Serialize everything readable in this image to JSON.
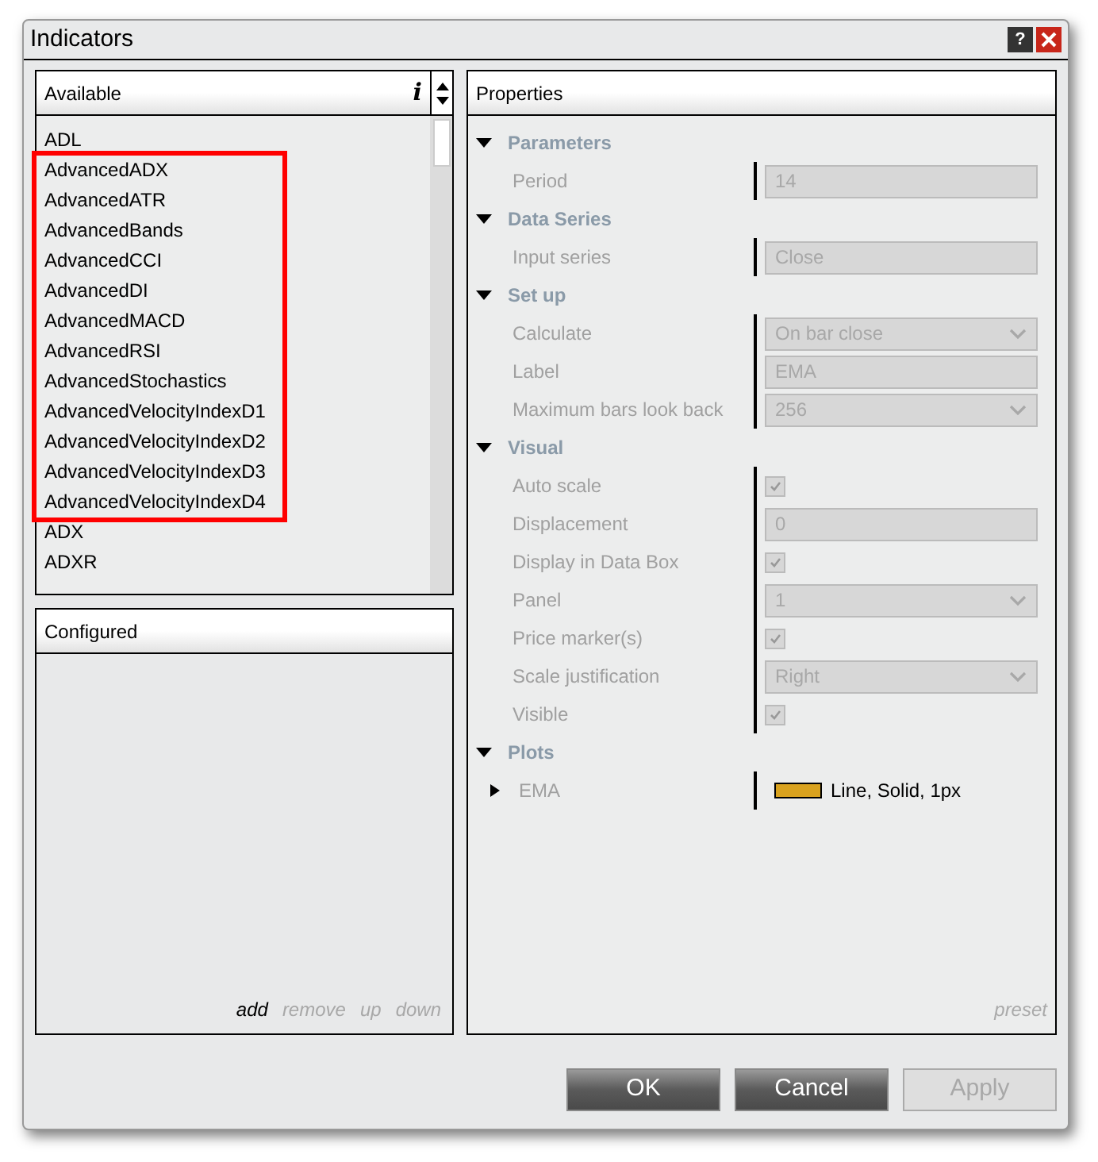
{
  "window": {
    "title": "Indicators",
    "help": "?"
  },
  "available": {
    "title": "Available",
    "info": "i",
    "items": [
      {
        "kind": "item",
        "label": "ADL"
      },
      {
        "kind": "highlight",
        "items": [
          {
            "label": "AdvancedADX"
          },
          {
            "label": "AdvancedATR"
          },
          {
            "label": "AdvancedBands"
          },
          {
            "label": "AdvancedCCI"
          },
          {
            "label": "AdvancedDI"
          },
          {
            "label": "AdvancedMACD"
          },
          {
            "label": "AdvancedRSI"
          },
          {
            "label": "AdvancedStochastics"
          },
          {
            "label": "AdvancedVelocityIndexD1"
          },
          {
            "label": "AdvancedVelocityIndexD2"
          },
          {
            "label": "AdvancedVelocityIndexD3"
          },
          {
            "label": "AdvancedVelocityIndexD4"
          }
        ]
      },
      {
        "kind": "item",
        "label": "ADX"
      },
      {
        "kind": "item",
        "label": "ADXR"
      }
    ]
  },
  "configured": {
    "title": "Configured",
    "actions": [
      {
        "label": "add",
        "disabled": false
      },
      {
        "label": "remove",
        "disabled": true
      },
      {
        "label": "up",
        "disabled": true
      },
      {
        "label": "down",
        "disabled": true
      }
    ]
  },
  "properties": {
    "title": "Properties",
    "footer": "preset",
    "categories": [
      {
        "name": "Parameters",
        "expanded": true,
        "rows": [
          {
            "kind": "text",
            "label": "Period",
            "value": "14"
          }
        ]
      },
      {
        "name": "Data Series",
        "expanded": true,
        "rows": [
          {
            "kind": "text",
            "label": "Input series",
            "value": "Close"
          }
        ]
      },
      {
        "name": "Set up",
        "expanded": true,
        "rows": [
          {
            "kind": "dropdown",
            "label": "Calculate",
            "value": "On bar close"
          },
          {
            "kind": "text",
            "label": "Label",
            "value": "EMA"
          },
          {
            "kind": "dropdown",
            "label": "Maximum bars look back",
            "value": "256"
          }
        ]
      },
      {
        "name": "Visual",
        "expanded": true,
        "rows": [
          {
            "kind": "checkbox",
            "label": "Auto scale",
            "checked": true
          },
          {
            "kind": "text",
            "label": "Displacement",
            "value": "0"
          },
          {
            "kind": "checkbox",
            "label": "Display in Data Box",
            "checked": true
          },
          {
            "kind": "dropdown",
            "label": "Panel",
            "value": "1"
          },
          {
            "kind": "checkbox",
            "label": "Price marker(s)",
            "checked": true
          },
          {
            "kind": "dropdown",
            "label": "Scale justification",
            "value": "Right"
          },
          {
            "kind": "checkbox",
            "label": "Visible",
            "checked": true
          }
        ]
      },
      {
        "name": "Plots",
        "expanded": true,
        "rows": [
          {
            "kind": "plot",
            "label": "EMA",
            "expanded": false,
            "color": "#d9a21e",
            "value": "Line, Solid, 1px"
          }
        ]
      }
    ]
  },
  "buttons": [
    {
      "label": "OK",
      "disabled": false
    },
    {
      "label": "Cancel",
      "disabled": false
    },
    {
      "label": "Apply",
      "disabled": true
    }
  ]
}
